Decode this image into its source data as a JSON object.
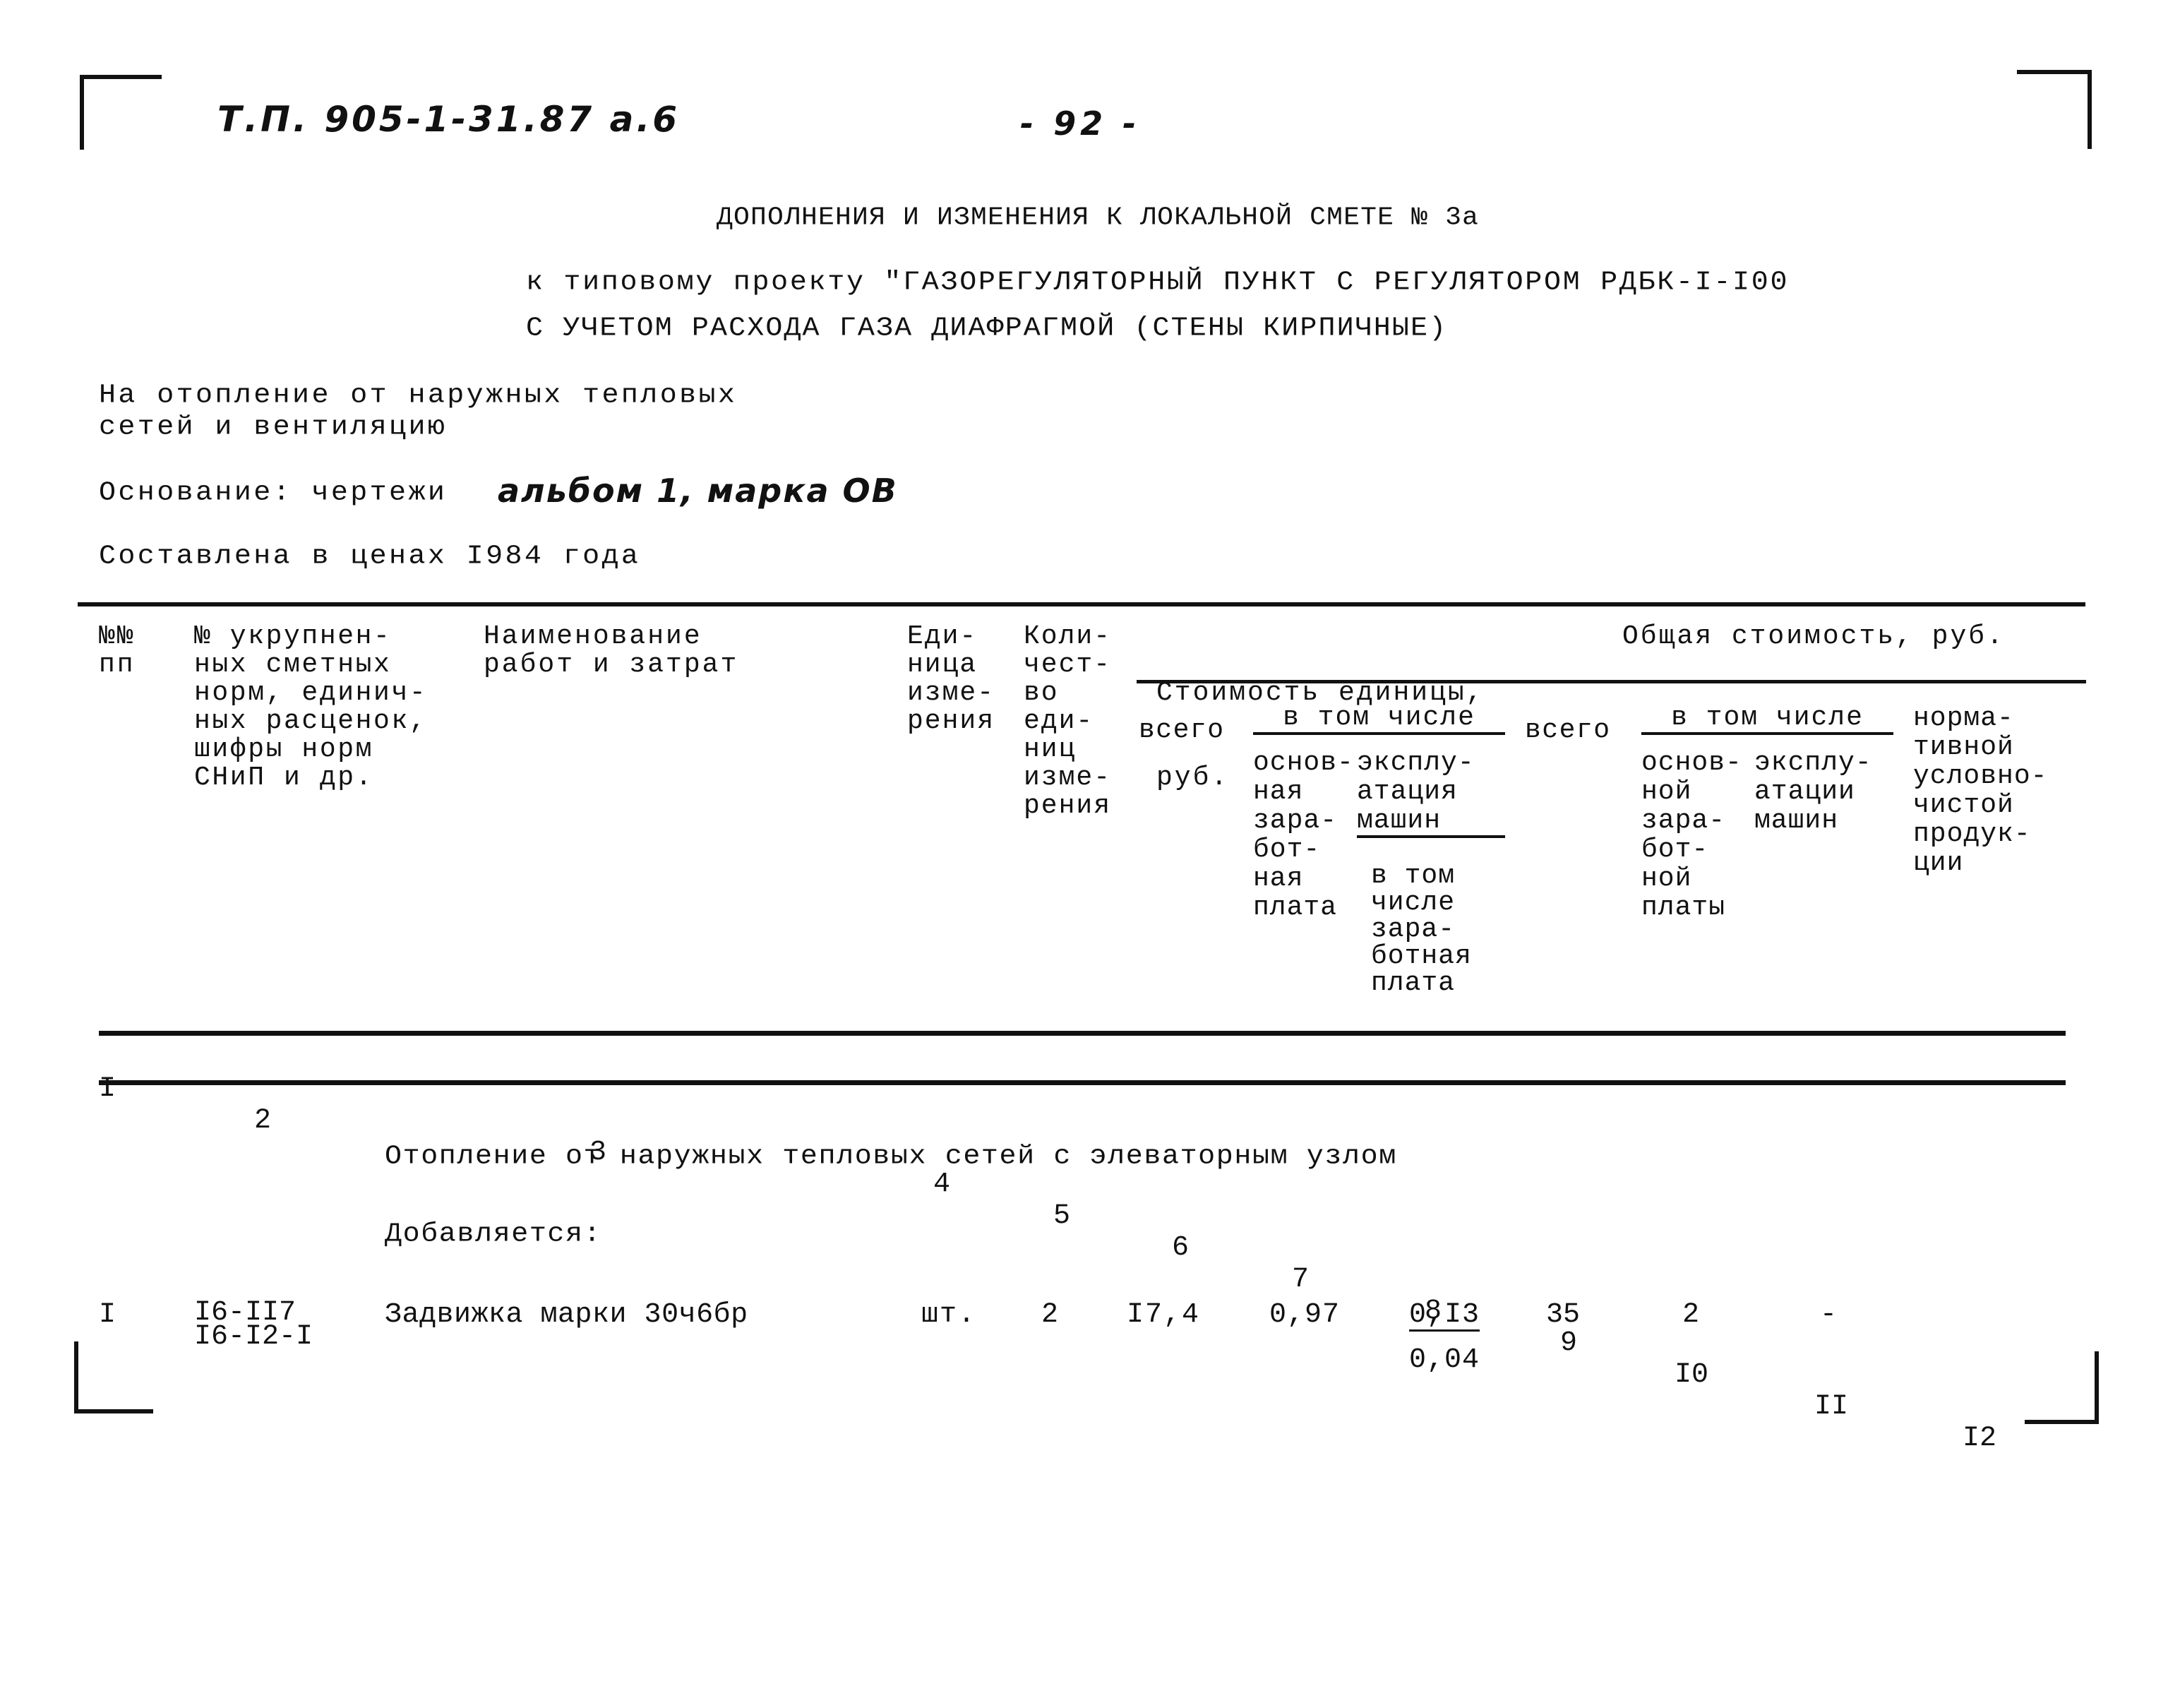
{
  "header": {
    "doc_code": "Т.П. 905-1-31.87 а.6",
    "page_number": "- 92 -"
  },
  "title": {
    "line1": "ДОПОЛНЕНИЯ И ИЗМЕНЕНИЯ К ЛОКАЛЬНОЙ СМЕТЕ № 3а",
    "line2": "к типовому проекту \"ГАЗОРЕГУЛЯТОРНЫЙ ПУНКТ С РЕГУЛЯТОРОМ РДБК-I-I00",
    "line3": "С УЧЕТОМ РАСХОДА ГАЗА ДИАФРАГМОЙ (СТЕНЫ КИРПИЧНЫЕ)"
  },
  "intro": {
    "purpose_line1": "На отопление от наружных тепловых",
    "purpose_line2": "сетей и вентиляцию",
    "basis_label": "Основание: чертежи",
    "basis_value": "альбом 1, марка ОВ",
    "prices": "Составлена в ценах I984 года"
  },
  "table": {
    "headers": {
      "c1": "№№\nпп",
      "c2": "№ укрупнен-\nных сметных\nнорм, единич-\nных расценок,\nшифры норм\nСНиП и др.",
      "c3": "Наименование\nработ и затрат",
      "c4": "Еди-\nница\nизме-\nрения",
      "c5": "Коли-\nчест-\nво\nеди-\nниц\nизме-\nрения",
      "unit_cost_group_line1": "Стоимость единицы,",
      "unit_cost_group_line2": "руб.",
      "c6": "всего",
      "unit_incl": "в том числе",
      "c7": "основ-\nная\nзара-\nбот-\nная\nплата",
      "c8_top": "эксплу-\nатация\nмашин",
      "c8_bottom": "в том\nчисле\nзара-\nботная\nплата",
      "total_cost_group": "Общая стоимость, руб.",
      "c9": "всего",
      "total_incl": "в том числе",
      "c10": "основ-\nной\nзара-\nбот-\nной\nплаты",
      "c11": "эксплу-\nатации\nмашин",
      "c12": "норма-\nтивной\nусловно-\nчистой\nпродук-\nции"
    },
    "column_numbers": [
      "I",
      "2",
      "3",
      "4",
      "5",
      "6",
      "7",
      "8",
      "9",
      "I0",
      "II",
      "I2"
    ],
    "section_title": "Отопление от наружных тепловых сетей с элеваторным узлом",
    "subsection_title": "Добавляется:",
    "rows": [
      {
        "num": "I",
        "codes": "I6-II7\nI6-I2-I",
        "name": "Задвижка марки 30ч6бр",
        "unit": "шт.",
        "qty": "2",
        "unit_total": "I7,4",
        "unit_wage": "0,97",
        "unit_machines": "0,I3",
        "unit_machines_wage": "0,04",
        "total": "35",
        "total_wage": "2",
        "total_machines": "-",
        "net_product": ""
      }
    ]
  }
}
